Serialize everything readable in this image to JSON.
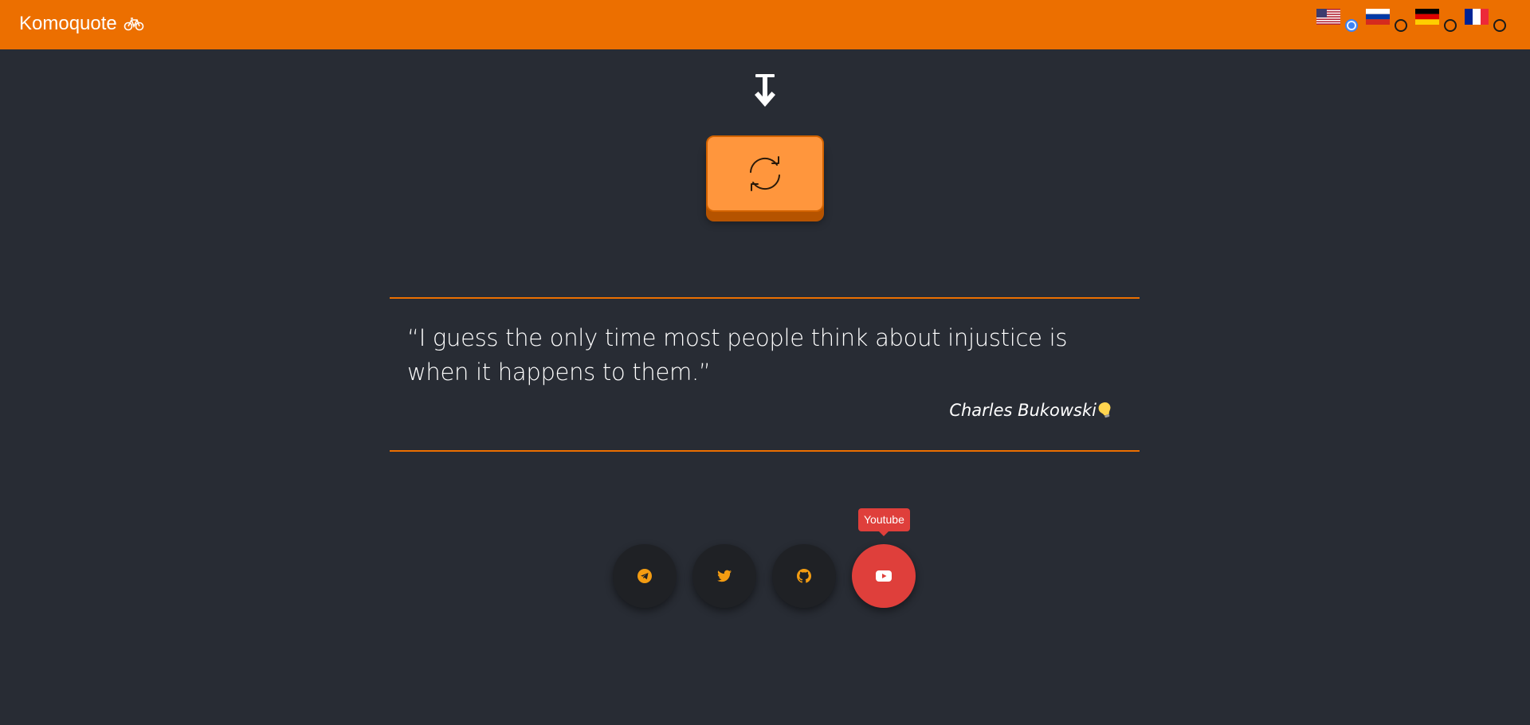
{
  "header": {
    "brand": "Komoquote",
    "brand_icon": "bicycle-icon",
    "accent_color": "#ec6f00"
  },
  "languages": [
    {
      "code": "en",
      "flag": "us-flag-icon",
      "selected": true
    },
    {
      "code": "ru",
      "flag": "russia-flag-icon",
      "selected": false
    },
    {
      "code": "de",
      "flag": "germany-flag-icon",
      "selected": false
    },
    {
      "code": "fr",
      "flag": "france-flag-icon",
      "selected": false
    }
  ],
  "main": {
    "arrow_icon": "arrow-down-to-line-icon",
    "refresh_icon": "refresh-icon"
  },
  "quote": {
    "text": "“I guess the only time most people think about injustice is when it happens to them.”",
    "author": "Charles Bukowski",
    "author_icon": "lightbulb-icon"
  },
  "social": {
    "items": [
      {
        "name": "Telegram",
        "icon": "telegram-icon"
      },
      {
        "name": "Twitter",
        "icon": "twitter-icon"
      },
      {
        "name": "Github",
        "icon": "github-icon"
      },
      {
        "name": "Youtube",
        "icon": "youtube-icon"
      }
    ],
    "tooltip": "Youtube",
    "active_color": "#df3f3b"
  }
}
